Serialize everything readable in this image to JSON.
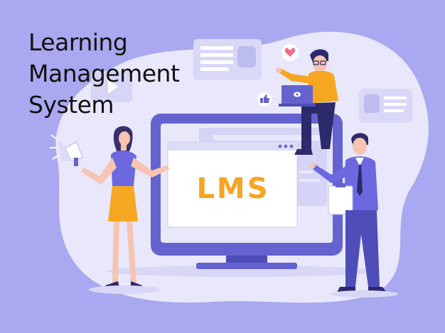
{
  "title": {
    "line1": "Learning",
    "line2": "Management",
    "line3": "System"
  },
  "screen": {
    "label": "LMS"
  },
  "colors": {
    "background": "#a9a8f0",
    "blob": "#e8e7fb",
    "monitor": "#6463cf",
    "accent": "#f5a623",
    "dark_navy": "#2d2a6b"
  },
  "icons": [
    "megaphone-icon",
    "play-icon",
    "heart-icon",
    "thumbs-up-icon",
    "laptop-icon",
    "clipboard-icon"
  ]
}
